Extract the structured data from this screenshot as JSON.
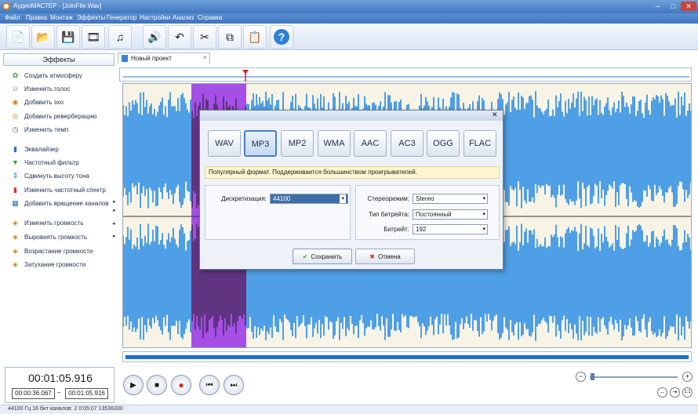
{
  "window": {
    "title": "АудиоМАСТЕР - [JoinFile.Wav]",
    "minimize": "─",
    "maximize": "□",
    "close": "✕"
  },
  "menu": [
    "Файл",
    "Правка",
    "Монтаж",
    "Эффекты",
    "Генератор",
    "Настройки",
    "Анализ",
    "Справка"
  ],
  "toolbar": {
    "icons": [
      "new-file-icon",
      "open-folder-icon",
      "save-icon",
      "add-video-icon",
      "record-icon",
      "play-effect-icon",
      "undo-icon",
      "cut-icon",
      "copy-icon",
      "paste-icon",
      "help-icon"
    ]
  },
  "effects_panel": {
    "header": "Эффекты",
    "items": [
      {
        "label": "Создать атмосферу"
      },
      {
        "label": "Изменить голос"
      },
      {
        "label": "Добавить эхо"
      },
      {
        "label": "Добавить реверберацию"
      },
      {
        "label": "Изменить темп"
      },
      {
        "label": "Эквалайзер"
      },
      {
        "label": "Частотный фильтр"
      },
      {
        "label": "Сдвинуть высоту тона"
      },
      {
        "label": "Изменить частотный спектр"
      },
      {
        "label": "Добавить вращение каналов"
      },
      {
        "label": "Изменить громкость"
      },
      {
        "label": "Выровнять громкость"
      },
      {
        "label": "Возрастание громкости"
      },
      {
        "label": "Затухание громкости"
      }
    ]
  },
  "tab": {
    "label": "Новый проект",
    "close": "×"
  },
  "time": {
    "current": "00:01:05.916",
    "start": "00:00:36.067",
    "separator": "–",
    "end": "00:01:05.916"
  },
  "transport": {
    "zoom_minus": "−",
    "zoom_plus": "+",
    "zoom_fit": "1:1"
  },
  "status": "44100 Гц  16 бит  каналов: 2   0:05:07 13536330",
  "dialog": {
    "close": "✕",
    "formats": [
      "WAV",
      "MP3",
      "MP2",
      "WMA",
      "AAC",
      "AC3",
      "OGG",
      "FLAC"
    ],
    "selected_format": "MP3",
    "info": "Популярный формат. Поддерживается большинством проигрывателей.",
    "sample_rate_label": "Дискретизация:",
    "sample_rate_value": "44100",
    "stereo_label": "Стереорежим:",
    "stereo_value": "Stereo",
    "bitrate_type_label": "Тип битрейта:",
    "bitrate_type_value": "Постоянный",
    "bitrate_label": "Битрейт:",
    "bitrate_value": "192",
    "save_label": "Сохранить",
    "cancel_label": "Отмена"
  },
  "colors": {
    "wave": "#4f9fe6",
    "selection": "#a54fe6",
    "marker": "#d8262b"
  }
}
